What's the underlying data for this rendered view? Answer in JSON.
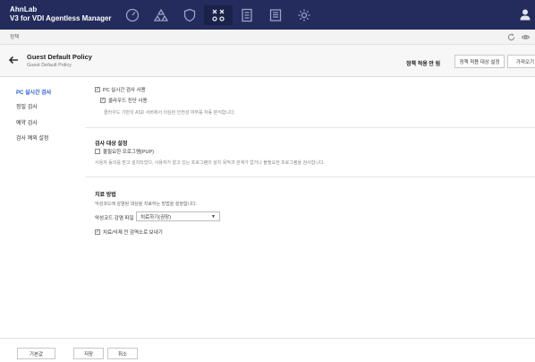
{
  "app": {
    "brand_line1": "AhnLab",
    "brand_line2": "V3 for VDI Agentless Manager"
  },
  "nav": {
    "icons": [
      "dashboard-icon",
      "agents-icon",
      "policy-shield-icon",
      "tasks-icon",
      "reports-icon",
      "logs-icon",
      "settings-gear-icon"
    ],
    "active": "tasks-icon"
  },
  "breadcrumb": {
    "text": "정책"
  },
  "header": {
    "title": "Guest Default Policy",
    "subtitle": "Guest Default Policy",
    "apply_status": "정책 적용 안 됨",
    "buttons": [
      "정책 적용 대상 설정",
      "가져오기"
    ]
  },
  "sidebar": {
    "items": [
      {
        "label": "PC 실시간 검사",
        "active": true
      },
      {
        "label": "정밀 검사",
        "active": false
      },
      {
        "label": "예약 검사",
        "active": false
      },
      {
        "label": "검사 예외 설정",
        "active": false
      }
    ]
  },
  "realtime": {
    "enable_label": "PC 실시간 검사 사용",
    "enable_checked": true,
    "cloud_label": "클라우드 진단 사용",
    "cloud_checked": true,
    "cloud_desc": "클라우드 기반의 ASD 서버에서 의심된 안전성 여부를 자동 분석합니다."
  },
  "scan_target": {
    "title": "검사 대상 설정",
    "pup_label": "불필요한 프로그램(PUP)",
    "pup_checked": false,
    "pup_desc": "사용자 동의를 받고 설치되었다, 사용자가 알고 있는 프로그램의 설치 목적과 관계가 없거나 불필요한 프로그램을 검사합니다."
  },
  "treatment": {
    "title": "치료 방법",
    "desc": "악성코드에 감염된 대상을 치료하는 방법을 설정합니다.",
    "file_label": "악성코드 감염 파일",
    "file_value": "치료하기(권장)",
    "quarantine_label": "치료/삭제 전 검역소로 보내기",
    "quarantine_checked": true
  },
  "footer": {
    "buttons": [
      "기본값",
      "저장",
      "취소"
    ]
  },
  "colors": {
    "topbar": "#232c5c",
    "active_link": "#2a5bd7"
  }
}
